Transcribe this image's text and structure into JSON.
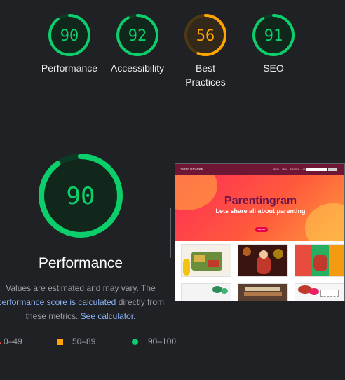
{
  "colors": {
    "background": "#202124",
    "pass": "#0cce6b",
    "pass_track": "#0d3a24",
    "pass_fill": "#11271c",
    "average": "#ffa400",
    "average_track": "#4d3a14",
    "average_fill": "#33291a",
    "fail": "#ff4e42",
    "link": "#8ab4f8",
    "muted": "#9aa0a6"
  },
  "scores": [
    {
      "id": "performance",
      "value": 90,
      "label": "Performance"
    },
    {
      "id": "accessibility",
      "value": 92,
      "label": "Accessibility"
    },
    {
      "id": "best-practices",
      "value": 56,
      "label": "Best Practices"
    },
    {
      "id": "seo",
      "value": 91,
      "label": "SEO"
    }
  ],
  "main": {
    "score": 90,
    "title": "Performance",
    "disclaimer_text1": "Values are estimated and may vary. The ",
    "disclaimer_link1": "performance score is calculated",
    "disclaimer_text2": " directly from these metrics. ",
    "disclaimer_link2": "See calculator."
  },
  "legend": {
    "fail_range": "0–49",
    "average_range": "50–89",
    "pass_range": "90–100"
  },
  "thumbnail": {
    "brand": "PARENTINGRAM",
    "nav_links": [
      "Home",
      "About",
      "Favorites",
      "Logout"
    ],
    "hero_title": "Parentingram",
    "hero_subtitle": "Lets share all about parenting",
    "hero_button": "Explore"
  }
}
